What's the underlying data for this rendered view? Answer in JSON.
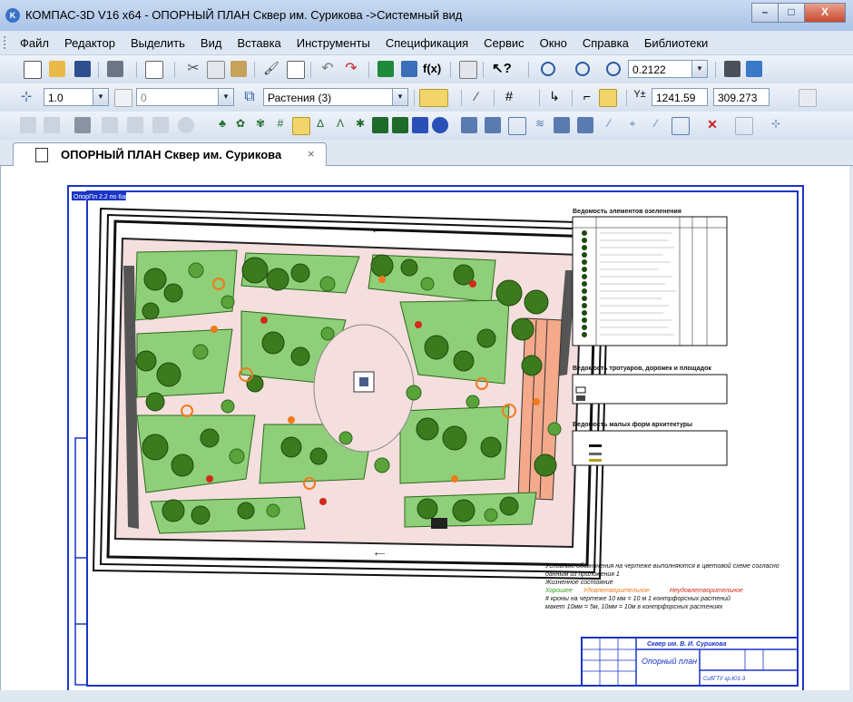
{
  "app": {
    "title": "КОМПАС-3D V16  x64 - ОПОРНЫЙ ПЛАН Сквер им. Сурикова ->Системный вид",
    "icon_text": "K",
    "window_buttons": {
      "minimize": "–",
      "maximize": "□",
      "close": "X"
    }
  },
  "menu": {
    "items": [
      "Файл",
      "Редактор",
      "Выделить",
      "Вид",
      "Вставка",
      "Инструменты",
      "Спецификация",
      "Сервис",
      "Окно",
      "Справка",
      "Библиотеки"
    ]
  },
  "toolbar1": {
    "zoom_value": "0.2122"
  },
  "toolbar2": {
    "step_value": "1.0",
    "angle_value": "0",
    "layer_value": "Растения (3)",
    "coord_x": "1241.59",
    "coord_y": "309.273"
  },
  "document": {
    "tab_label": "ОПОРНЫЙ ПЛАН Сквер им. Сурикова",
    "tab_close": "×"
  },
  "drawing": {
    "stamp_corner": "ОпорПл 2.2 по 6арм",
    "legend_title_1": "Ведомость элементов озеленения",
    "legend_title_2": "Ведомость тротуаров, дорожек и площадок",
    "legend_title_3": "Ведомость малых форм архитектуры",
    "note_1": "Условные обозначения на чертеже выполняются в цветовой схеме согласно данным из приложения 1",
    "note_2": "Жизненное состояние",
    "state_good": "Хорошее",
    "state_satisfactory": "Удовлетворительное",
    "state_unsatisfactory": "Неудовлетворительное",
    "note_3": "# кроны на чертеже 10 мм = 10 м 1 контрфорсных растений",
    "note_4": "макет 10мм = 5м, 10мм = 10м в контрфорсных растениях",
    "title_block_name": "Сквер им. В. И. Сурикова",
    "title_block_sheet": "Опорный план",
    "title_block_code": "СибГТУ гр.Ю1-3"
  },
  "colors": {
    "lawn": "#8fcf7a",
    "tree_dark": "#3c7a1e",
    "tree_mid": "#5aa33a",
    "orange": "#f07a1a",
    "red": "#d42a1a",
    "paving": "#f5dede",
    "road_dark": "#222222",
    "building": "#555555",
    "frame_blue": "#1a35c8",
    "salmon": "#f4a98a"
  }
}
